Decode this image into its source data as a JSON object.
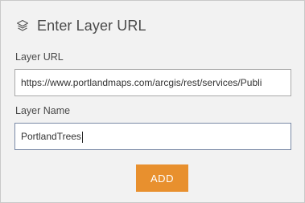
{
  "header": {
    "icon": "layers-icon",
    "title": "Enter Layer URL"
  },
  "layer_url": {
    "label": "Layer URL",
    "value": "https://www.portlandmaps.com/arcgis/rest/services/Publi"
  },
  "layer_name": {
    "label": "Layer Name",
    "value": "PortlandTrees"
  },
  "add_button": {
    "label": "ADD"
  },
  "colors": {
    "accent": "#e8902e",
    "panel_bg": "#f2f2f2",
    "text": "#4a4a4a"
  }
}
